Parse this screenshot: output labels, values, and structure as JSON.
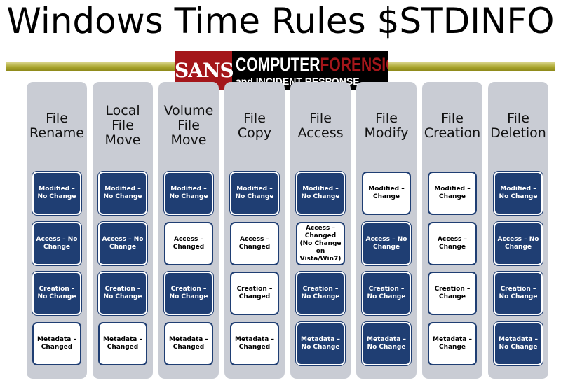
{
  "title": "Windows Time Rules $STDINFO",
  "logo": {
    "sans": "SANS",
    "computer": "COMPUTER",
    "forensics": "FORENSICS",
    "subtitle": "and INCIDENT RESPONSE"
  },
  "colors": {
    "no_change_fill": "#1f3e73",
    "changed_fill": "#ffffff",
    "column_bg": "#c9ccd4",
    "divider_bar": "#aaa62e",
    "logo_red": "#a4161a"
  },
  "columns": [
    {
      "header": "File Rename",
      "cells": [
        {
          "text": "Modified – No Change",
          "state": "nochange"
        },
        {
          "text": "Access – No Change",
          "state": "nochange"
        },
        {
          "text": "Creation – No Change",
          "state": "nochange"
        },
        {
          "text": "Metadata – Changed",
          "state": "changed"
        }
      ]
    },
    {
      "header": "Local File Move",
      "cells": [
        {
          "text": "Modified – No Change",
          "state": "nochange"
        },
        {
          "text": "Access – No Change",
          "state": "nochange"
        },
        {
          "text": "Creation – No Change",
          "state": "nochange"
        },
        {
          "text": "Metadata – Changed",
          "state": "changed"
        }
      ]
    },
    {
      "header": "Volume File Move",
      "cells": [
        {
          "text": "Modified – No Change",
          "state": "nochange"
        },
        {
          "text": "Access – Changed",
          "state": "changed"
        },
        {
          "text": "Creation – No Change",
          "state": "nochange"
        },
        {
          "text": "Metadata – Changed",
          "state": "changed"
        }
      ]
    },
    {
      "header": "File Copy",
      "cells": [
        {
          "text": "Modified – No Change",
          "state": "nochange"
        },
        {
          "text": "Access – Changed",
          "state": "changed"
        },
        {
          "text": "Creation – Changed",
          "state": "changed"
        },
        {
          "text": "Metadata – Changed",
          "state": "changed"
        }
      ]
    },
    {
      "header": "File Access",
      "cells": [
        {
          "text": "Modified – No Change",
          "state": "nochange"
        },
        {
          "text": "Access – Changed (No Change on Vista/Win7)",
          "state": "changed"
        },
        {
          "text": "Creation – No Change",
          "state": "nochange"
        },
        {
          "text": "Metadata – No Change",
          "state": "nochange"
        }
      ]
    },
    {
      "header": "File Modify",
      "cells": [
        {
          "text": "Modified – Change",
          "state": "changed"
        },
        {
          "text": "Access – No Change",
          "state": "nochange"
        },
        {
          "text": "Creation – No Change",
          "state": "nochange"
        },
        {
          "text": "Metadata – No Change",
          "state": "nochange"
        }
      ]
    },
    {
      "header": "File Creation",
      "cells": [
        {
          "text": "Modified – Change",
          "state": "changed"
        },
        {
          "text": "Access – Change",
          "state": "changed"
        },
        {
          "text": "Creation – Change",
          "state": "changed"
        },
        {
          "text": "Metadata – Change",
          "state": "changed"
        }
      ]
    },
    {
      "header": "File Deletion",
      "cells": [
        {
          "text": "Modified – No Change",
          "state": "nochange"
        },
        {
          "text": "Access – No Change",
          "state": "nochange"
        },
        {
          "text": "Creation – No Change",
          "state": "nochange"
        },
        {
          "text": "Metadata – No Change",
          "state": "nochange"
        }
      ]
    }
  ]
}
